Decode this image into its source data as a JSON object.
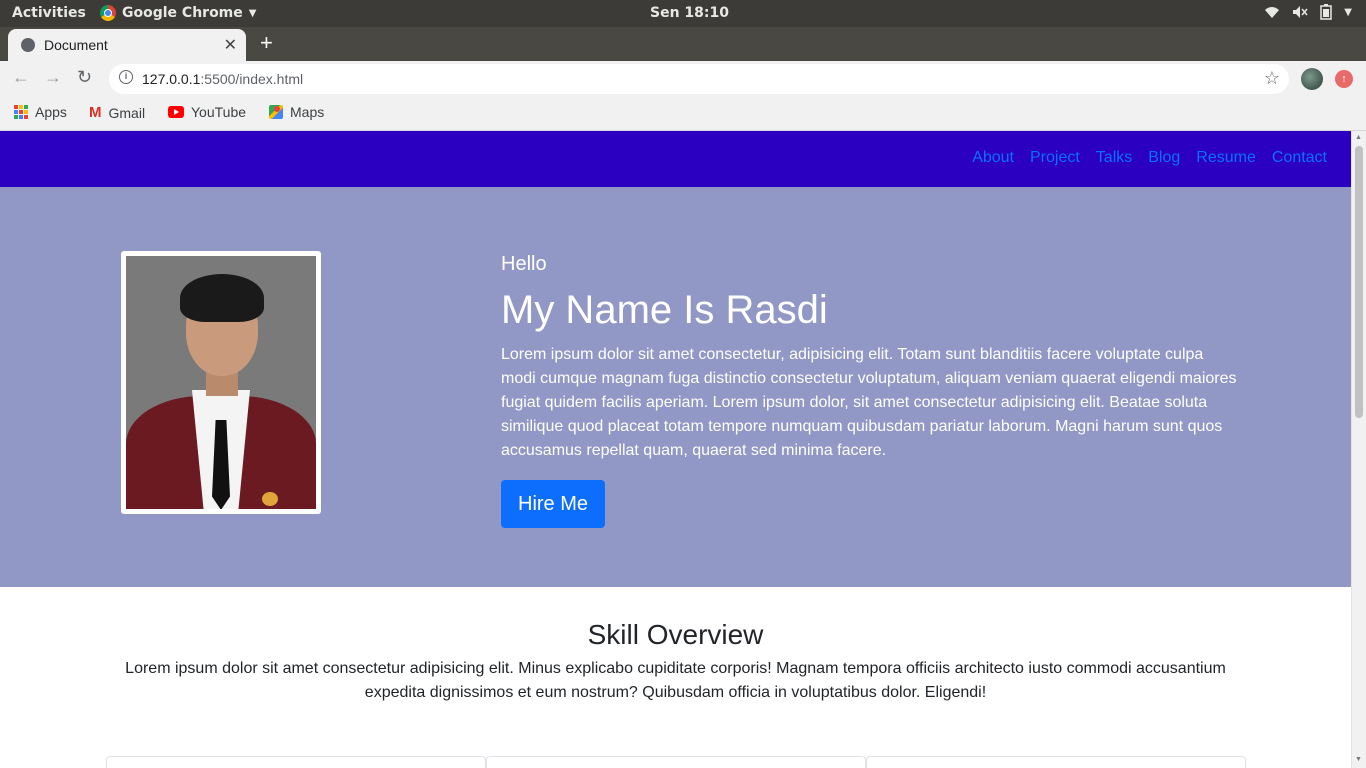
{
  "os": {
    "activities": "Activities",
    "app_name": "Google Chrome",
    "clock": "Sen 18:10"
  },
  "browser": {
    "tab_title": "Document",
    "url_host": "127.0.0.1",
    "url_rest": ":5500/index.html",
    "bookmarks": [
      {
        "label": "Apps",
        "icon": "apps-grid-icon"
      },
      {
        "label": "Gmail",
        "icon": "gmail-icon"
      },
      {
        "label": "YouTube",
        "icon": "youtube-icon"
      },
      {
        "label": "Maps",
        "icon": "maps-icon"
      }
    ]
  },
  "site": {
    "nav": [
      "About",
      "Project",
      "Talks",
      "Blog",
      "Resume",
      "Contact"
    ],
    "colors": {
      "navbar": "#2b00c1",
      "hero": "#9198c5",
      "link": "#0d6efd",
      "button": "#0d6efd"
    },
    "hero": {
      "greeting": "Hello",
      "title": "My Name Is Rasdi",
      "description": "Lorem ipsum dolor sit amet consectetur, adipisicing elit. Totam sunt blanditiis facere voluptate culpa modi cumque magnam fuga distinctio consectetur voluptatum, aliquam veniam quaerat eligendi maiores fugiat quidem facilis aperiam. Lorem ipsum dolor, sit amet consectetur adipisicing elit. Beatae soluta similique quod placeat totam tempore numquam quibusdam pariatur laborum. Magni harum sunt quos accusamus repellat quam, quaerat sed minima facere.",
      "button": "Hire Me"
    },
    "skills": {
      "title": "Skill Overview",
      "description": "Lorem ipsum dolor sit amet consectetur adipisicing elit. Minus explicabo cupiditate corporis! Magnam tempora officiis architecto iusto commodi accusantium expedita dignissimos et eum nostrum? Quibusdam officia in voluptatibus dolor. Eligendi!"
    }
  }
}
